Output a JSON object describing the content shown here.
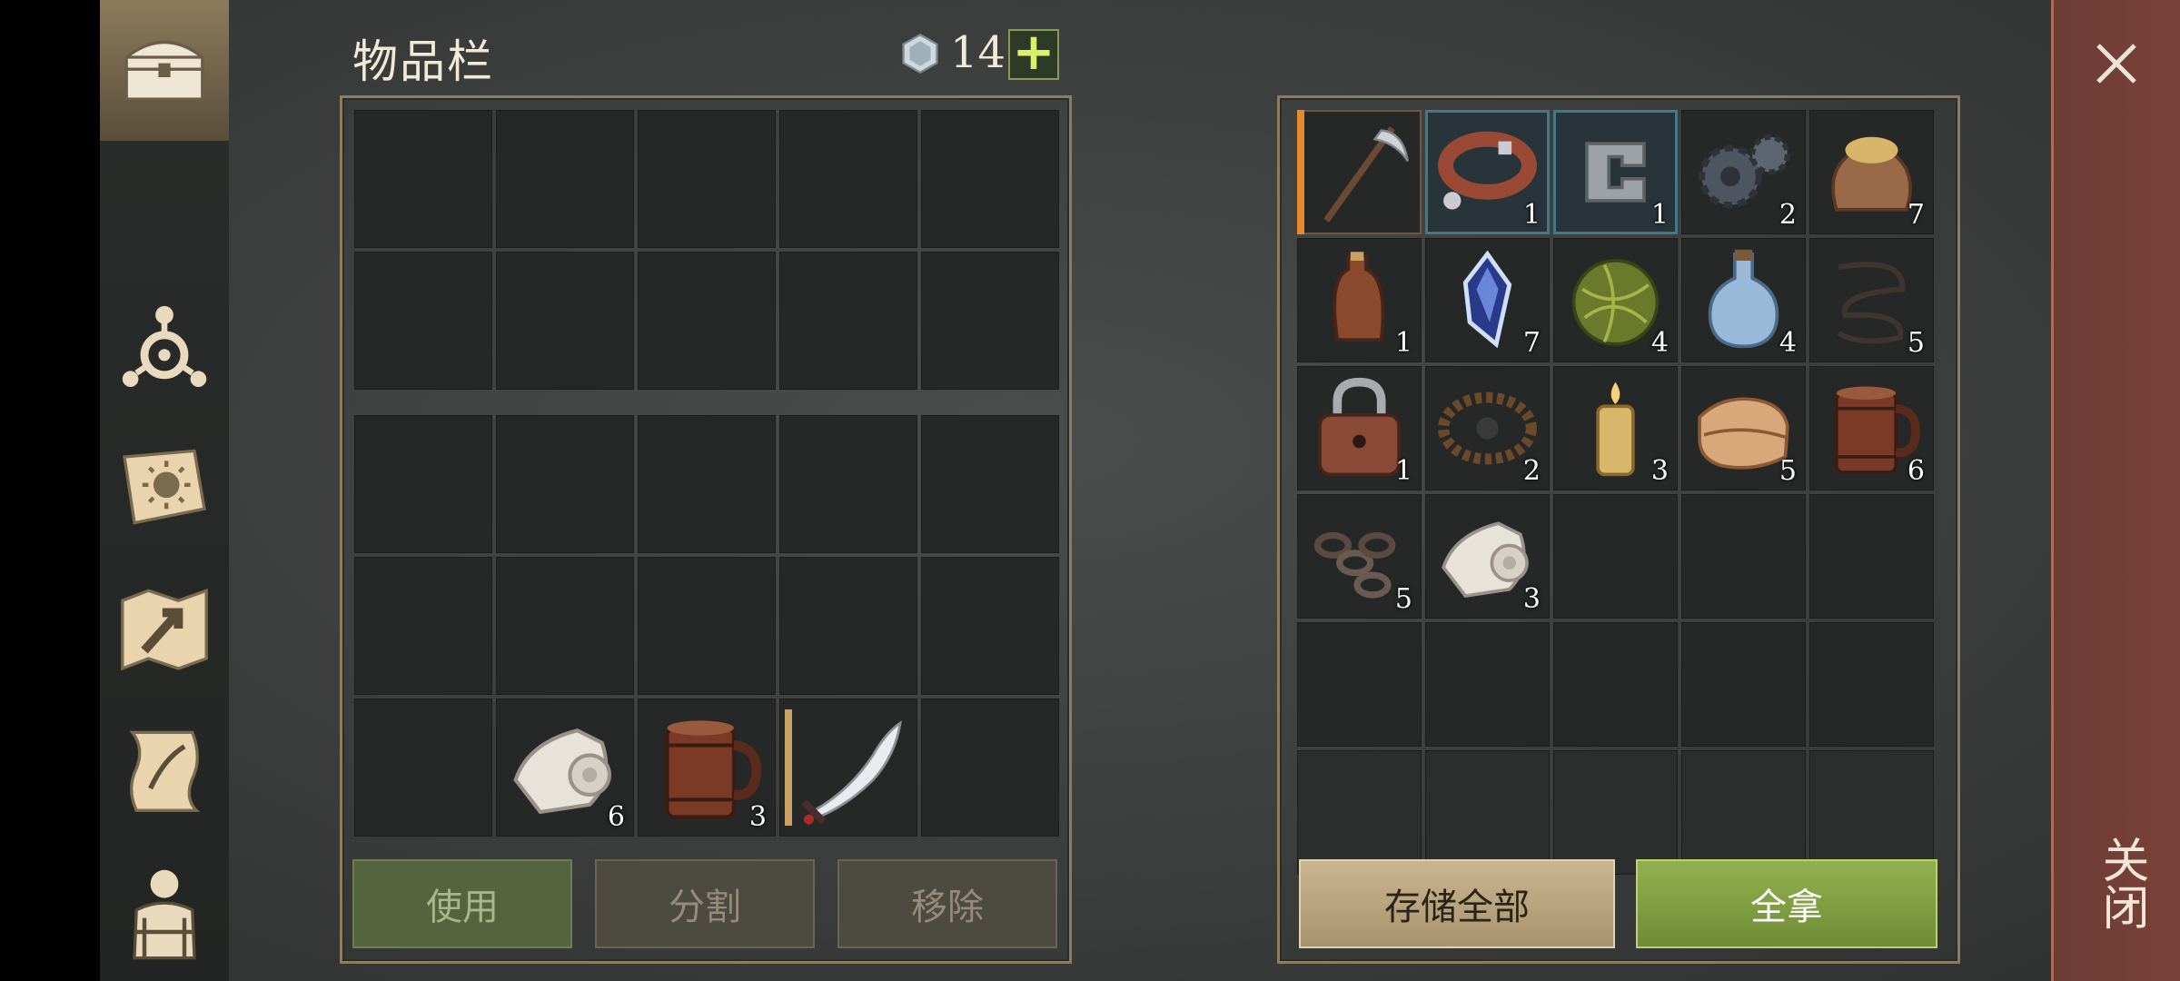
{
  "header": {
    "title": "物品栏",
    "currency_icon": "gem-icon",
    "currency_value": "14",
    "plus_label": "+"
  },
  "nav": [
    {
      "name": "chest-icon"
    },
    {
      "name": "crafting-icon"
    },
    {
      "name": "tech-book-icon"
    },
    {
      "name": "map-icon"
    },
    {
      "name": "quest-scroll-icon"
    },
    {
      "name": "character-icon"
    }
  ],
  "backpack": {
    "rows": 5,
    "cols": 5,
    "items": [
      {
        "slot": 21,
        "icon": "bandage-roll-icon",
        "qty": "6"
      },
      {
        "slot": 22,
        "icon": "wooden-mug-icon",
        "qty": "3"
      },
      {
        "slot": 23,
        "icon": "scimitar-icon",
        "qty": ""
      }
    ]
  },
  "storage": {
    "rows": 6,
    "cols": 5,
    "items": [
      {
        "slot": 0,
        "icon": "scythe-icon",
        "qty": ""
      },
      {
        "slot": 1,
        "icon": "leather-collar-icon",
        "qty": "1"
      },
      {
        "slot": 2,
        "icon": "metal-clamp-icon",
        "qty": "1"
      },
      {
        "slot": 3,
        "icon": "gears-icon",
        "qty": "2"
      },
      {
        "slot": 4,
        "icon": "grain-sack-icon",
        "qty": "7"
      },
      {
        "slot": 5,
        "icon": "leather-flask-icon",
        "qty": "1"
      },
      {
        "slot": 6,
        "icon": "crystal-icon",
        "qty": "7"
      },
      {
        "slot": 7,
        "icon": "grass-ball-icon",
        "qty": "4"
      },
      {
        "slot": 8,
        "icon": "potion-bottle-icon",
        "qty": "4"
      },
      {
        "slot": 9,
        "icon": "wire-icon",
        "qty": "5"
      },
      {
        "slot": 10,
        "icon": "padlock-icon",
        "qty": "1"
      },
      {
        "slot": 11,
        "icon": "bear-trap-icon",
        "qty": "2"
      },
      {
        "slot": 12,
        "icon": "candle-icon",
        "qty": "3"
      },
      {
        "slot": 13,
        "icon": "cloth-icon",
        "qty": "5"
      },
      {
        "slot": 14,
        "icon": "wooden-mug-icon",
        "qty": "6"
      },
      {
        "slot": 15,
        "icon": "chain-icon",
        "qty": "5"
      },
      {
        "slot": 16,
        "icon": "bandage-roll-icon",
        "qty": "3"
      }
    ]
  },
  "buttons": {
    "use": "使用",
    "split": "分割",
    "remove": "移除",
    "store_all": "存储全部",
    "take_all": "全拿"
  },
  "close": {
    "label": "关闭",
    "icon": "close-icon"
  },
  "colors": {
    "accent_green": "#93b04f",
    "frame_gold": "#8c7d5d",
    "selection_orange": "#e8892a",
    "selection_blue": "#3f7a8a"
  }
}
